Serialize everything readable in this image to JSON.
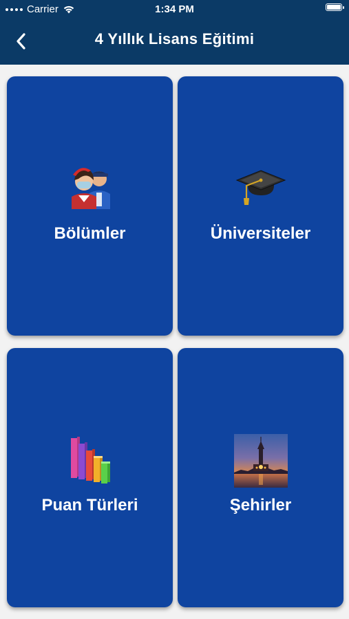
{
  "status_bar": {
    "carrier": "Carrier",
    "time": "1:34 PM"
  },
  "nav": {
    "title": "4 Yıllık Lisans Eğitimi",
    "back_icon": "chevron-left-icon"
  },
  "colors": {
    "header_bg": "#0b3a66",
    "card_bg": "#0f44a0",
    "page_bg": "#f2f2f2"
  },
  "cards": [
    {
      "label": "Bölümler",
      "icon": "people-icon"
    },
    {
      "label": "Üniversiteler",
      "icon": "graduation-cap-icon"
    },
    {
      "label": "Puan Türleri",
      "icon": "bar-chart-icon"
    },
    {
      "label": "Şehirler",
      "icon": "city-photo-icon"
    }
  ]
}
